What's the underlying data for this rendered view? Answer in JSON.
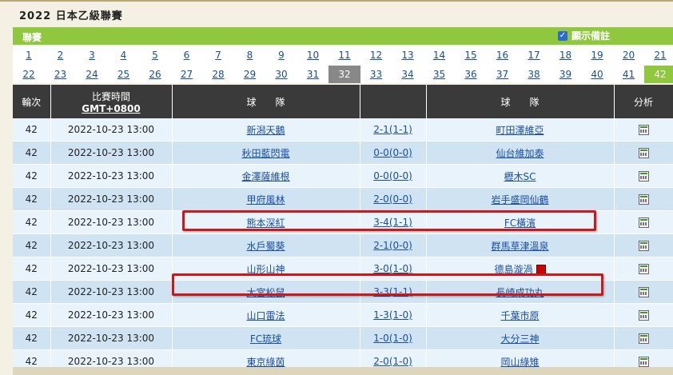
{
  "title": "2022 日本乙級聯賽",
  "league_label": "聯賽",
  "remark_label": "顯示備註",
  "rounds_row1": [
    "1",
    "2",
    "3",
    "4",
    "5",
    "6",
    "7",
    "8",
    "9",
    "10",
    "11",
    "12",
    "13",
    "14",
    "15",
    "16",
    "17",
    "18",
    "19",
    "20",
    "21"
  ],
  "rounds_row2": [
    "22",
    "23",
    "24",
    "25",
    "26",
    "27",
    "28",
    "29",
    "30",
    "31",
    "32",
    "33",
    "34",
    "35",
    "36",
    "37",
    "38",
    "39",
    "40",
    "41",
    "42"
  ],
  "headers": {
    "round": "輪次",
    "time_line1": "比賽時間",
    "time_line2": "GMT+0800",
    "team": "球　　隊",
    "analysis": "分析"
  },
  "matches": [
    {
      "round": "42",
      "time": "2022-10-23 13:00",
      "home": "新潟天鵝",
      "score": "2-1(1-1)",
      "away": "町田澤維亞"
    },
    {
      "round": "42",
      "time": "2022-10-23 13:00",
      "home": "秋田藍閃電",
      "score": "0-0(0-0)",
      "away": "仙台維加泰"
    },
    {
      "round": "42",
      "time": "2022-10-23 13:00",
      "home": "金澤薩維根",
      "score": "0-0(0-0)",
      "away": "櫪木SC"
    },
    {
      "round": "42",
      "time": "2022-10-23 13:00",
      "home": "甲府風林",
      "score": "2-0(0-0)",
      "away": "岩手盛岡仙鶴"
    },
    {
      "round": "42",
      "time": "2022-10-23 13:00",
      "home": "熊本深紅",
      "score": "3-4(1-1)",
      "away": "FC橫濱"
    },
    {
      "round": "42",
      "time": "2022-10-23 13:00",
      "home": "水戶蜀葵",
      "score": "2-1(0-0)",
      "away": "群馬草津溫泉"
    },
    {
      "round": "42",
      "time": "2022-10-23 13:00",
      "home": "山形山神",
      "score": "3-0(1-0)",
      "away": "德島漩渦"
    },
    {
      "round": "42",
      "time": "2022-10-23 13:00",
      "home": "大宮松鼠",
      "score": "3-3(1-1)",
      "away": "長崎成功丸"
    },
    {
      "round": "42",
      "time": "2022-10-23 13:00",
      "home": "山口雷法",
      "score": "1-3(1-0)",
      "away": "千葉市原"
    },
    {
      "round": "42",
      "time": "2022-10-23 13:00",
      "home": "FC琉球",
      "score": "1-0(1-0)",
      "away": "大分三神"
    },
    {
      "round": "42",
      "time": "2022-10-23 13:00",
      "home": "東京綠茵",
      "score": "2-0(1-0)",
      "away": "岡山綠雉"
    }
  ]
}
